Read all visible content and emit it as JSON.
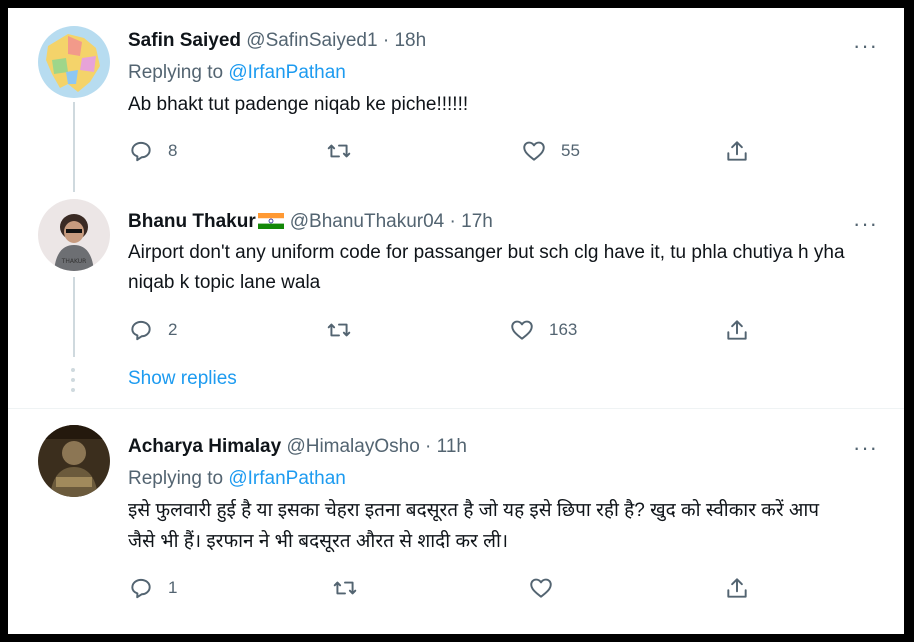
{
  "tweets": [
    {
      "name": "Safin Saiyed",
      "handle": "@SafinSaiyed1",
      "dot": "·",
      "time": "18h",
      "replying_prefix": "Replying to ",
      "replying_to": "@IrfanPathan",
      "text": "Ab bhakt tut padenge niqab ke piche!!!!!!",
      "reply_count": "8",
      "retweet_count": "",
      "like_count": "55",
      "more": "···"
    },
    {
      "name": "Bhanu Thakur",
      "handle": "@BhanuThakur04",
      "dot": "·",
      "time": "17h",
      "text": "Airport don't any uniform code for passanger but sch clg have it, tu phla chutiya h yha niqab k topic lane wala",
      "reply_count": "2",
      "retweet_count": "",
      "like_count": "163",
      "more": "···"
    },
    {
      "name": "Acharya Himalay",
      "handle": "@HimalayOsho",
      "dot": "·",
      "time": "11h",
      "replying_prefix": "Replying to ",
      "replying_to": "@IrfanPathan",
      "text": "इसे फुलवारी हुई है या इसका चेहरा इतना बदसूरत है जो यह इसे छिपा रही है? खुद को स्वीकार करें आप जैसे भी हैं। इरफान ने भी बदसूरत औरत से शादी कर ली।",
      "reply_count": "1",
      "retweet_count": "",
      "like_count": "",
      "more": "···"
    }
  ],
  "show_replies": "Show replies",
  "colors": {
    "accent": "#1d9bf0",
    "secondary_text": "#536471",
    "primary_text": "#0f1419",
    "thread_line": "#cfd9de"
  }
}
